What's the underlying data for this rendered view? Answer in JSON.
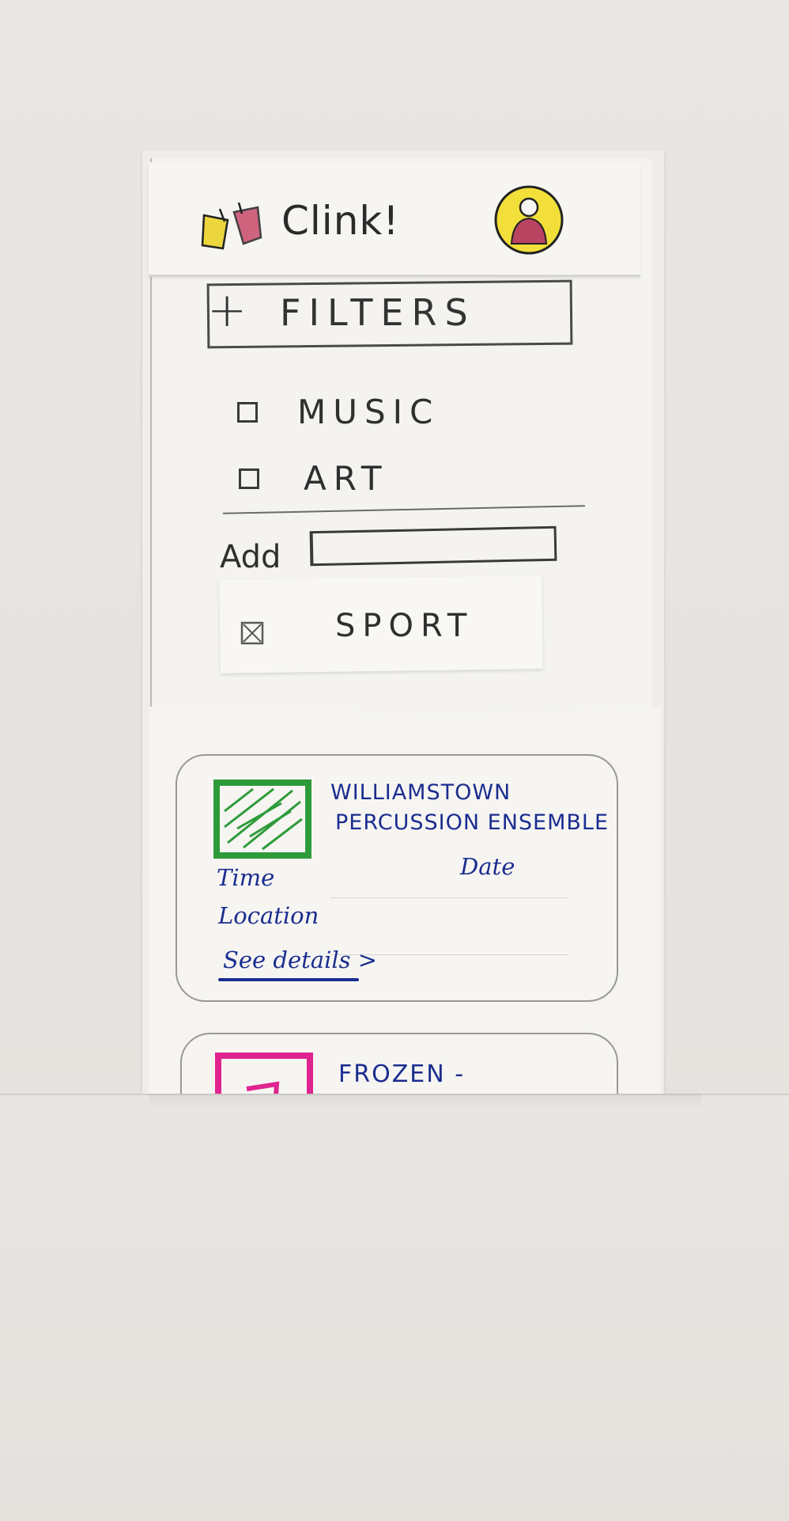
{
  "app": {
    "title": "Clink!"
  },
  "header": {
    "logo_icon": "drink-cups-icon",
    "profile_icon": "user-avatar-icon"
  },
  "filters": {
    "toggle_symbol": "+",
    "label": "FILTERS",
    "options": [
      {
        "label": "MUSIC",
        "checked": false
      },
      {
        "label": "ART",
        "checked": false
      }
    ],
    "add_label": "Add",
    "add_value": "",
    "added": {
      "label": "SPORT",
      "checked": true
    }
  },
  "events": [
    {
      "title_line1": "WILLIAMSTOWN",
      "title_line2": "PERCUSSION ENSEMBLE",
      "time_label": "Time",
      "date_label": "Date",
      "location_label": "Location",
      "details_link": "See details >",
      "thumb_color": "#2e9b3a"
    },
    {
      "title_line1": "FROZEN -",
      "thumb_color": "#e0248f"
    }
  ],
  "colors": {
    "ink_blue": "#1b2d8f",
    "pencil": "#333333",
    "avatar_yellow": "#f2df3a",
    "avatar_person": "#b84462",
    "logo_yellow": "#ecd63d",
    "logo_red": "#c94a6a"
  }
}
